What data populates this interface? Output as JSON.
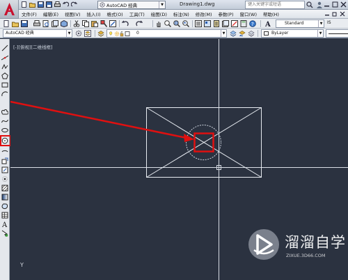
{
  "titlebar": {
    "workspace": "AutoCAD 经典",
    "document": "Drawing1.dwg",
    "search_placeholder": "键入关键字或短语"
  },
  "menus": [
    {
      "label": "文件(F)"
    },
    {
      "label": "编辑(E)"
    },
    {
      "label": "视图(V)"
    },
    {
      "label": "插入(I)"
    },
    {
      "label": "格式(O)"
    },
    {
      "label": "工具(T)"
    },
    {
      "label": "绘图(D)"
    },
    {
      "label": "标注(N)"
    },
    {
      "label": "修改(M)"
    },
    {
      "label": "参数(P)"
    },
    {
      "label": "窗口(W)"
    },
    {
      "label": "帮助(H)"
    }
  ],
  "toolbar1": {
    "text_style": "Standard",
    "dim_style_prefix": "IS"
  },
  "toolbar2": {
    "workspace": "AutoCAD 经典",
    "layer": "0",
    "color": "ByLayer"
  },
  "viewport": {
    "label": "[-][俯视][二维线框]",
    "ucs_axis": "Y"
  },
  "watermark": {
    "title": "溜溜自学",
    "url": "ZIXUE.3D66.COM"
  },
  "colors": {
    "canvas_bg": "#2b3240",
    "highlight": "#e01010",
    "drawing_lines": "#e8ecf2"
  }
}
